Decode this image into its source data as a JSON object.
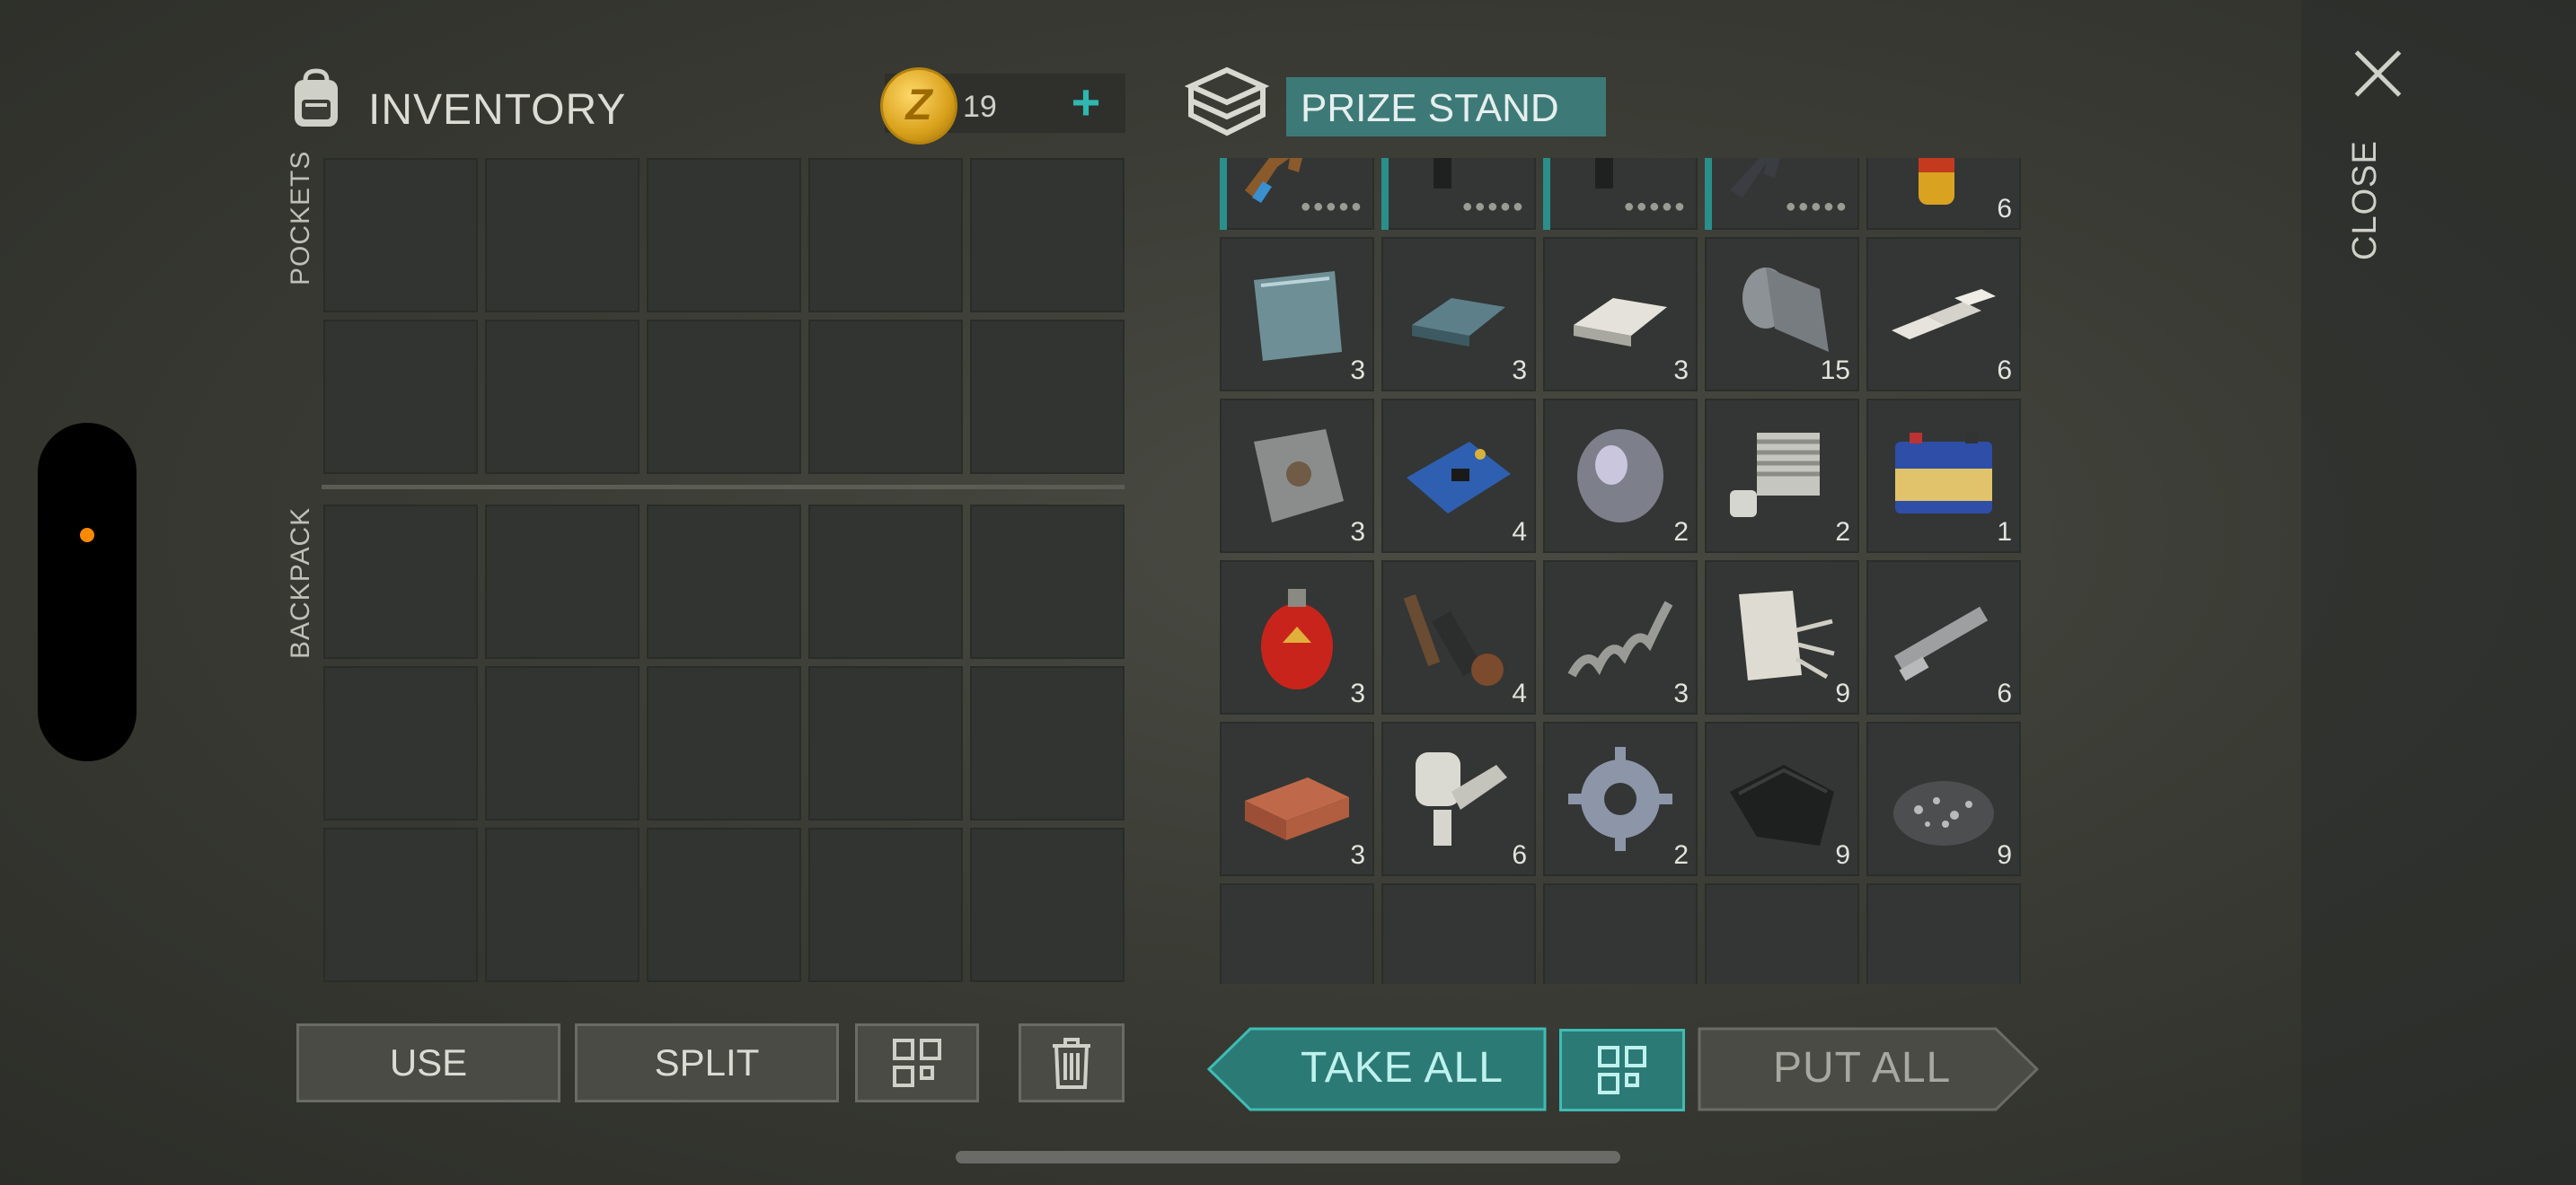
{
  "inventory": {
    "title": "INVENTORY",
    "coins": "19"
  },
  "pockets_label": "POCKETS",
  "backpack_label": "BACKPACK",
  "prize_stand": {
    "title": "PRIZE STAND"
  },
  "close_label": "CLOSE",
  "prize_items": [
    {
      "name": "ak-rifle",
      "qty": "",
      "weapon": true
    },
    {
      "name": "uzi-smg",
      "qty": "",
      "weapon": true
    },
    {
      "name": "uzi-smg-2",
      "qty": "",
      "weapon": true
    },
    {
      "name": "m16-rifle",
      "qty": "",
      "weapon": true
    },
    {
      "name": "spray-can",
      "qty": "6"
    },
    {
      "name": "steel-plate",
      "qty": "3"
    },
    {
      "name": "steel-ingot",
      "qty": "3"
    },
    {
      "name": "aluminum-ingot",
      "qty": "3"
    },
    {
      "name": "metal-sheet-roll",
      "qty": "15"
    },
    {
      "name": "aluminum-bars",
      "qty": "6"
    },
    {
      "name": "scrap-plate",
      "qty": "3"
    },
    {
      "name": "circuit-board",
      "qty": "4"
    },
    {
      "name": "lens",
      "qty": "2"
    },
    {
      "name": "engine-cylinder",
      "qty": "2"
    },
    {
      "name": "battery",
      "qty": "1"
    },
    {
      "name": "gas-cylinder",
      "qty": "3"
    },
    {
      "name": "parts-kit",
      "qty": "4"
    },
    {
      "name": "spring",
      "qty": "3"
    },
    {
      "name": "fiberglass",
      "qty": "9"
    },
    {
      "name": "pipe-parts",
      "qty": "6"
    },
    {
      "name": "brick",
      "qty": "3"
    },
    {
      "name": "mechanical-parts",
      "qty": "6"
    },
    {
      "name": "gear",
      "qty": "2"
    },
    {
      "name": "black-cloth",
      "qty": "9"
    },
    {
      "name": "gravel",
      "qty": "9"
    },
    {
      "name": "empty",
      "qty": ""
    },
    {
      "name": "empty",
      "qty": ""
    },
    {
      "name": "empty",
      "qty": ""
    },
    {
      "name": "empty",
      "qty": ""
    },
    {
      "name": "empty",
      "qty": ""
    }
  ],
  "buttons": {
    "use": "USE",
    "split": "SPLIT",
    "take_all": "TAKE ALL",
    "put_all": "PUT ALL"
  },
  "colors": {
    "accent_teal": "#2fb7b0",
    "tab_teal": "#3d7a77",
    "coin_gold": "#d9a11b"
  }
}
